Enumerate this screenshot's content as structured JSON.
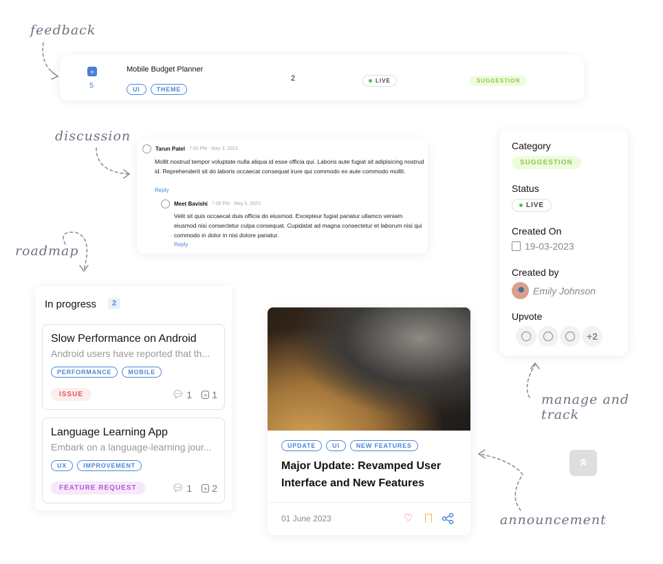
{
  "labels": {
    "feedback": "feedback",
    "discussion": "discussion",
    "roadmap": "roadmap",
    "manage": "manage and track",
    "announcement": "announcement"
  },
  "feedback_row": {
    "upvotes": "5",
    "title": "Mobile Budget Planner",
    "tags": [
      "UI",
      "THEME"
    ],
    "comments": "2",
    "status": "LIVE",
    "category": "SUGGESTION"
  },
  "discussion": {
    "comment": {
      "author": "Tarun Patel",
      "time": "7:00 PM · May 3, 2023",
      "text": "Mollit nostrud tempor voluptate nulla aliqua id esse officia qui. Laboris aute fugiat sit adipisicing nostrud id. Reprehenderit sit do laboris occaecat consequat irure qui commodo ex aute commodo mollit.",
      "reply": "Reply"
    },
    "reply": {
      "author": "Meet Bavishi",
      "time": "7:00 PM · May 5, 2023",
      "text": "Velit sit quis occaecat duis officia do eiusmod. Excepteur fugiat pariatur ullamco veniam eiusmod nisi consectetur culpa consequat. Cupidatat ad magna consectetur et laborum nisi qui commodo in dolor in nisi dolore pariatur.",
      "reply": "Reply"
    }
  },
  "roadmap": {
    "column": "In progress",
    "count": "2",
    "items": [
      {
        "title": "Slow Performance on Android",
        "desc": "Android users have reported that th...",
        "tags": [
          "PERFORMANCE",
          "MOBILE"
        ],
        "category": "ISSUE",
        "comments": "1",
        "upvotes": "1"
      },
      {
        "title": "Language Learning App",
        "desc": "Embark on a language-learning jour...",
        "tags": [
          "UX",
          "IMPROVEMENT"
        ],
        "category": "FEATURE REQUEST",
        "comments": "1",
        "upvotes": "2"
      }
    ]
  },
  "announcement": {
    "tags": [
      "UPDATE",
      "UI",
      "NEW FEATURES"
    ],
    "title": "Major Update: Revamped User Interface and New Features",
    "date": "01 June 2023"
  },
  "details": {
    "category_label": "Category",
    "category": "SUGGESTION",
    "status_label": "Status",
    "status": "LIVE",
    "created_on_label": "Created On",
    "created_on": "19-03-2023",
    "created_by_label": "Created by",
    "created_by": "Emily Johnson",
    "upvote_label": "Upvote",
    "upvote_more": "+2"
  },
  "colors": {
    "accent": "#4a86d6",
    "suggestion": "#8cc850",
    "issue": "#e05555",
    "feature": "#b457d6",
    "live": "#5cb85c"
  }
}
